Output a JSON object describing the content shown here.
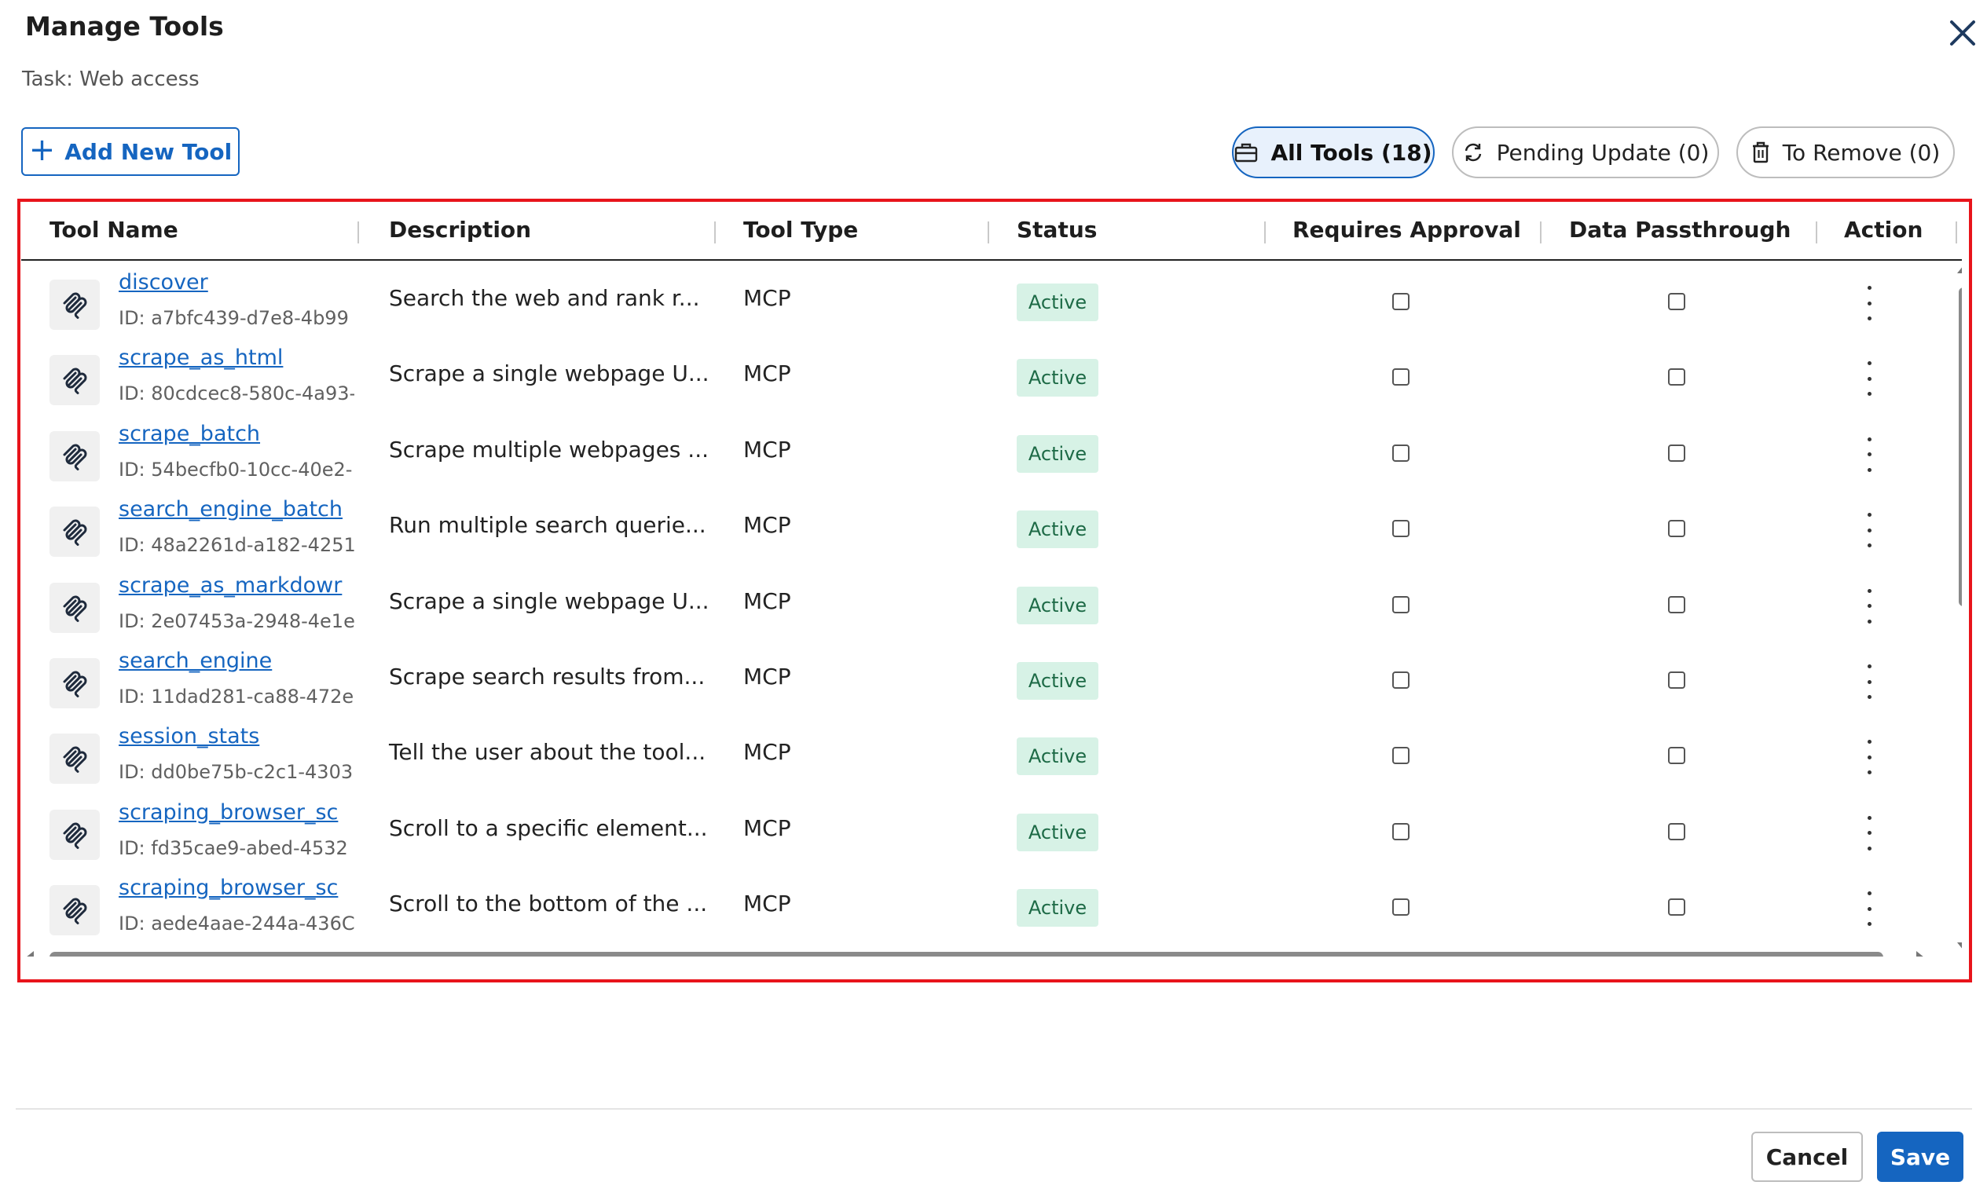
{
  "dialog": {
    "title": "Manage Tools",
    "subtitle": "Task: Web access"
  },
  "toolbar": {
    "add_label": "Add New Tool",
    "filters": [
      {
        "label": "All Tools (18)",
        "icon": "toolbox-icon",
        "active": true
      },
      {
        "label": "Pending Update (0)",
        "icon": "refresh-icon",
        "active": false
      },
      {
        "label": "To Remove (0)",
        "icon": "trash-icon",
        "active": false
      }
    ]
  },
  "table": {
    "columns": [
      "Tool Name",
      "Description",
      "Tool Type",
      "Status",
      "Requires Approval",
      "Data Passthrough",
      "Action"
    ],
    "rows": [
      {
        "name": "discover",
        "id": "ID: a7bfc439-d7e8-4b99",
        "description": "Search the web and rank r...",
        "type": "MCP",
        "status": "Active",
        "requires_approval": false,
        "data_passthrough": false
      },
      {
        "name": "scrape_as_html",
        "id": "ID: 80cdcec8-580c-4a93-",
        "description": "Scrape a single webpage U...",
        "type": "MCP",
        "status": "Active",
        "requires_approval": false,
        "data_passthrough": false
      },
      {
        "name": "scrape_batch",
        "id": "ID: 54becfb0-10cc-40e2-",
        "description": "Scrape multiple webpages ...",
        "type": "MCP",
        "status": "Active",
        "requires_approval": false,
        "data_passthrough": false
      },
      {
        "name": "search_engine_batch",
        "id": "ID: 48a2261d-a182-4251",
        "description": "Run multiple search querie...",
        "type": "MCP",
        "status": "Active",
        "requires_approval": false,
        "data_passthrough": false
      },
      {
        "name": "scrape_as_markdowr",
        "id": "ID: 2e07453a-2948-4e1e",
        "description": "Scrape a single webpage U...",
        "type": "MCP",
        "status": "Active",
        "requires_approval": false,
        "data_passthrough": false
      },
      {
        "name": "search_engine",
        "id": "ID: 11dad281-ca88-472e",
        "description": "Scrape search results from...",
        "type": "MCP",
        "status": "Active",
        "requires_approval": false,
        "data_passthrough": false
      },
      {
        "name": "session_stats",
        "id": "ID: dd0be75b-c2c1-4303",
        "description": "Tell the user about the tool...",
        "type": "MCP",
        "status": "Active",
        "requires_approval": false,
        "data_passthrough": false
      },
      {
        "name": "scraping_browser_sc",
        "id": "ID: fd35cae9-abed-4532",
        "description": "Scroll to a specific element...",
        "type": "MCP",
        "status": "Active",
        "requires_approval": false,
        "data_passthrough": false
      },
      {
        "name": "scraping_browser_sc",
        "id": "ID: aede4aae-244a-436C",
        "description": "Scroll to the bottom of the ...",
        "type": "MCP",
        "status": "Active",
        "requires_approval": false,
        "data_passthrough": false
      }
    ]
  },
  "footer": {
    "cancel_label": "Cancel",
    "save_label": "Save"
  },
  "colors": {
    "accent": "#1565c0",
    "highlight_border": "#e8141b",
    "status_bg": "#d7f2e6",
    "status_text": "#1d6a46"
  }
}
